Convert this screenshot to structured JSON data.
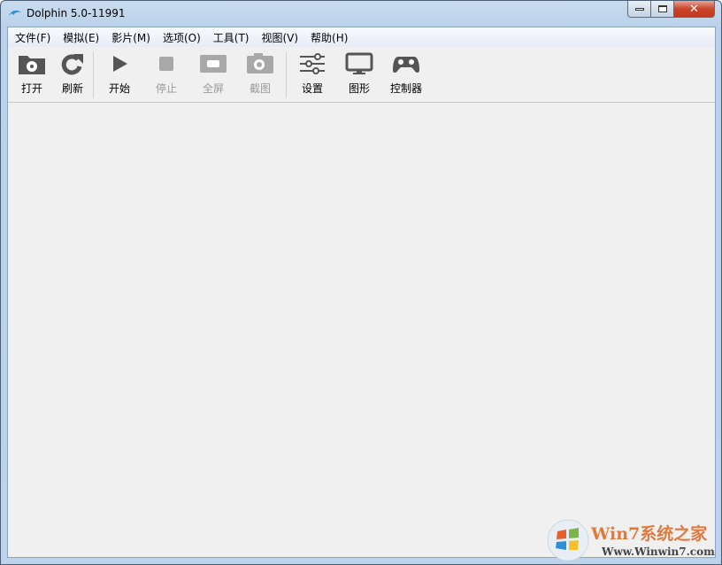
{
  "window": {
    "title": "Dolphin 5.0-11991",
    "icon": "dolphin-icon"
  },
  "menu": [
    "文件(F)",
    "模拟(E)",
    "影片(M)",
    "选项(O)",
    "工具(T)",
    "视图(V)",
    "帮助(H)"
  ],
  "toolbar": [
    {
      "label": "打开",
      "icon": "open-folder-disc-icon",
      "enabled": true
    },
    {
      "label": "刷新",
      "icon": "refresh-icon",
      "enabled": true
    },
    {
      "label": "开始",
      "icon": "play-icon",
      "enabled": true
    },
    {
      "label": "停止",
      "icon": "stop-icon",
      "enabled": false
    },
    {
      "label": "全屏",
      "icon": "fullscreen-icon",
      "enabled": false
    },
    {
      "label": "截图",
      "icon": "camera-icon",
      "enabled": false
    },
    {
      "label": "设置",
      "icon": "sliders-icon",
      "enabled": true
    },
    {
      "label": "图形",
      "icon": "monitor-icon",
      "enabled": true
    },
    {
      "label": "控制器",
      "icon": "gamepad-icon",
      "enabled": true
    }
  ],
  "watermark": {
    "brand": "Win7系统之家",
    "url": "Www.Winwin7.com"
  },
  "colors": {
    "close": "#c8452c",
    "icon": "#555555",
    "icon_disabled": "#a8a8a8"
  }
}
